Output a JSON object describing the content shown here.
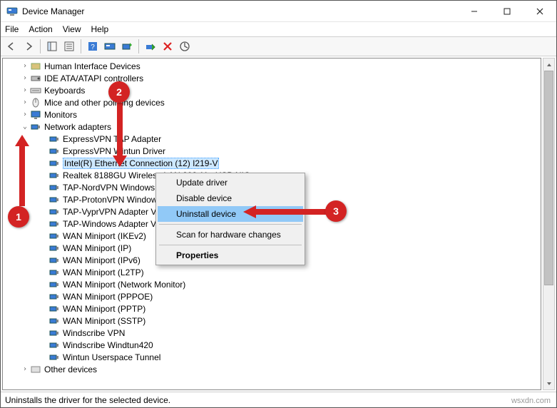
{
  "window": {
    "title": "Device Manager"
  },
  "menu": {
    "file": "File",
    "action": "Action",
    "view": "View",
    "help": "Help"
  },
  "tree": {
    "categories": [
      {
        "label": "Human Interface Devices",
        "expanded": false
      },
      {
        "label": "IDE ATA/ATAPI controllers",
        "expanded": false
      },
      {
        "label": "Keyboards",
        "expanded": false
      },
      {
        "label": "Mice and other pointing devices",
        "expanded": false
      },
      {
        "label": "Monitors",
        "expanded": false
      },
      {
        "label": "Network adapters",
        "expanded": true
      },
      {
        "label": "Other devices",
        "expanded": false
      }
    ],
    "networkAdapters": [
      "ExpressVPN TAP Adapter",
      "ExpressVPN Wintun Driver",
      "Intel(R) Ethernet Connection (12) I219-V",
      "Realtek 8188GU Wireless LAN 802.11n USB NIC",
      "TAP-NordVPN Windows Adapter V9",
      "TAP-ProtonVPN Windows Adapter V9",
      "TAP-VyprVPN Adapter V9",
      "TAP-Windows Adapter V9",
      "WAN Miniport (IKEv2)",
      "WAN Miniport (IP)",
      "WAN Miniport (IPv6)",
      "WAN Miniport (L2TP)",
      "WAN Miniport (Network Monitor)",
      "WAN Miniport (PPPOE)",
      "WAN Miniport (PPTP)",
      "WAN Miniport (SSTP)",
      "Windscribe VPN",
      "Windscribe Windtun420",
      "Wintun Userspace Tunnel"
    ],
    "selectedIndex": 2
  },
  "contextMenu": {
    "items": {
      "update": "Update driver",
      "disable": "Disable device",
      "uninstall": "Uninstall device",
      "scan": "Scan for hardware changes",
      "properties": "Properties"
    }
  },
  "status": {
    "text": "Uninstalls the driver for the selected device."
  },
  "watermark": "wsxdn.com",
  "annotations": {
    "b1": "1",
    "b2": "2",
    "b3": "3"
  }
}
